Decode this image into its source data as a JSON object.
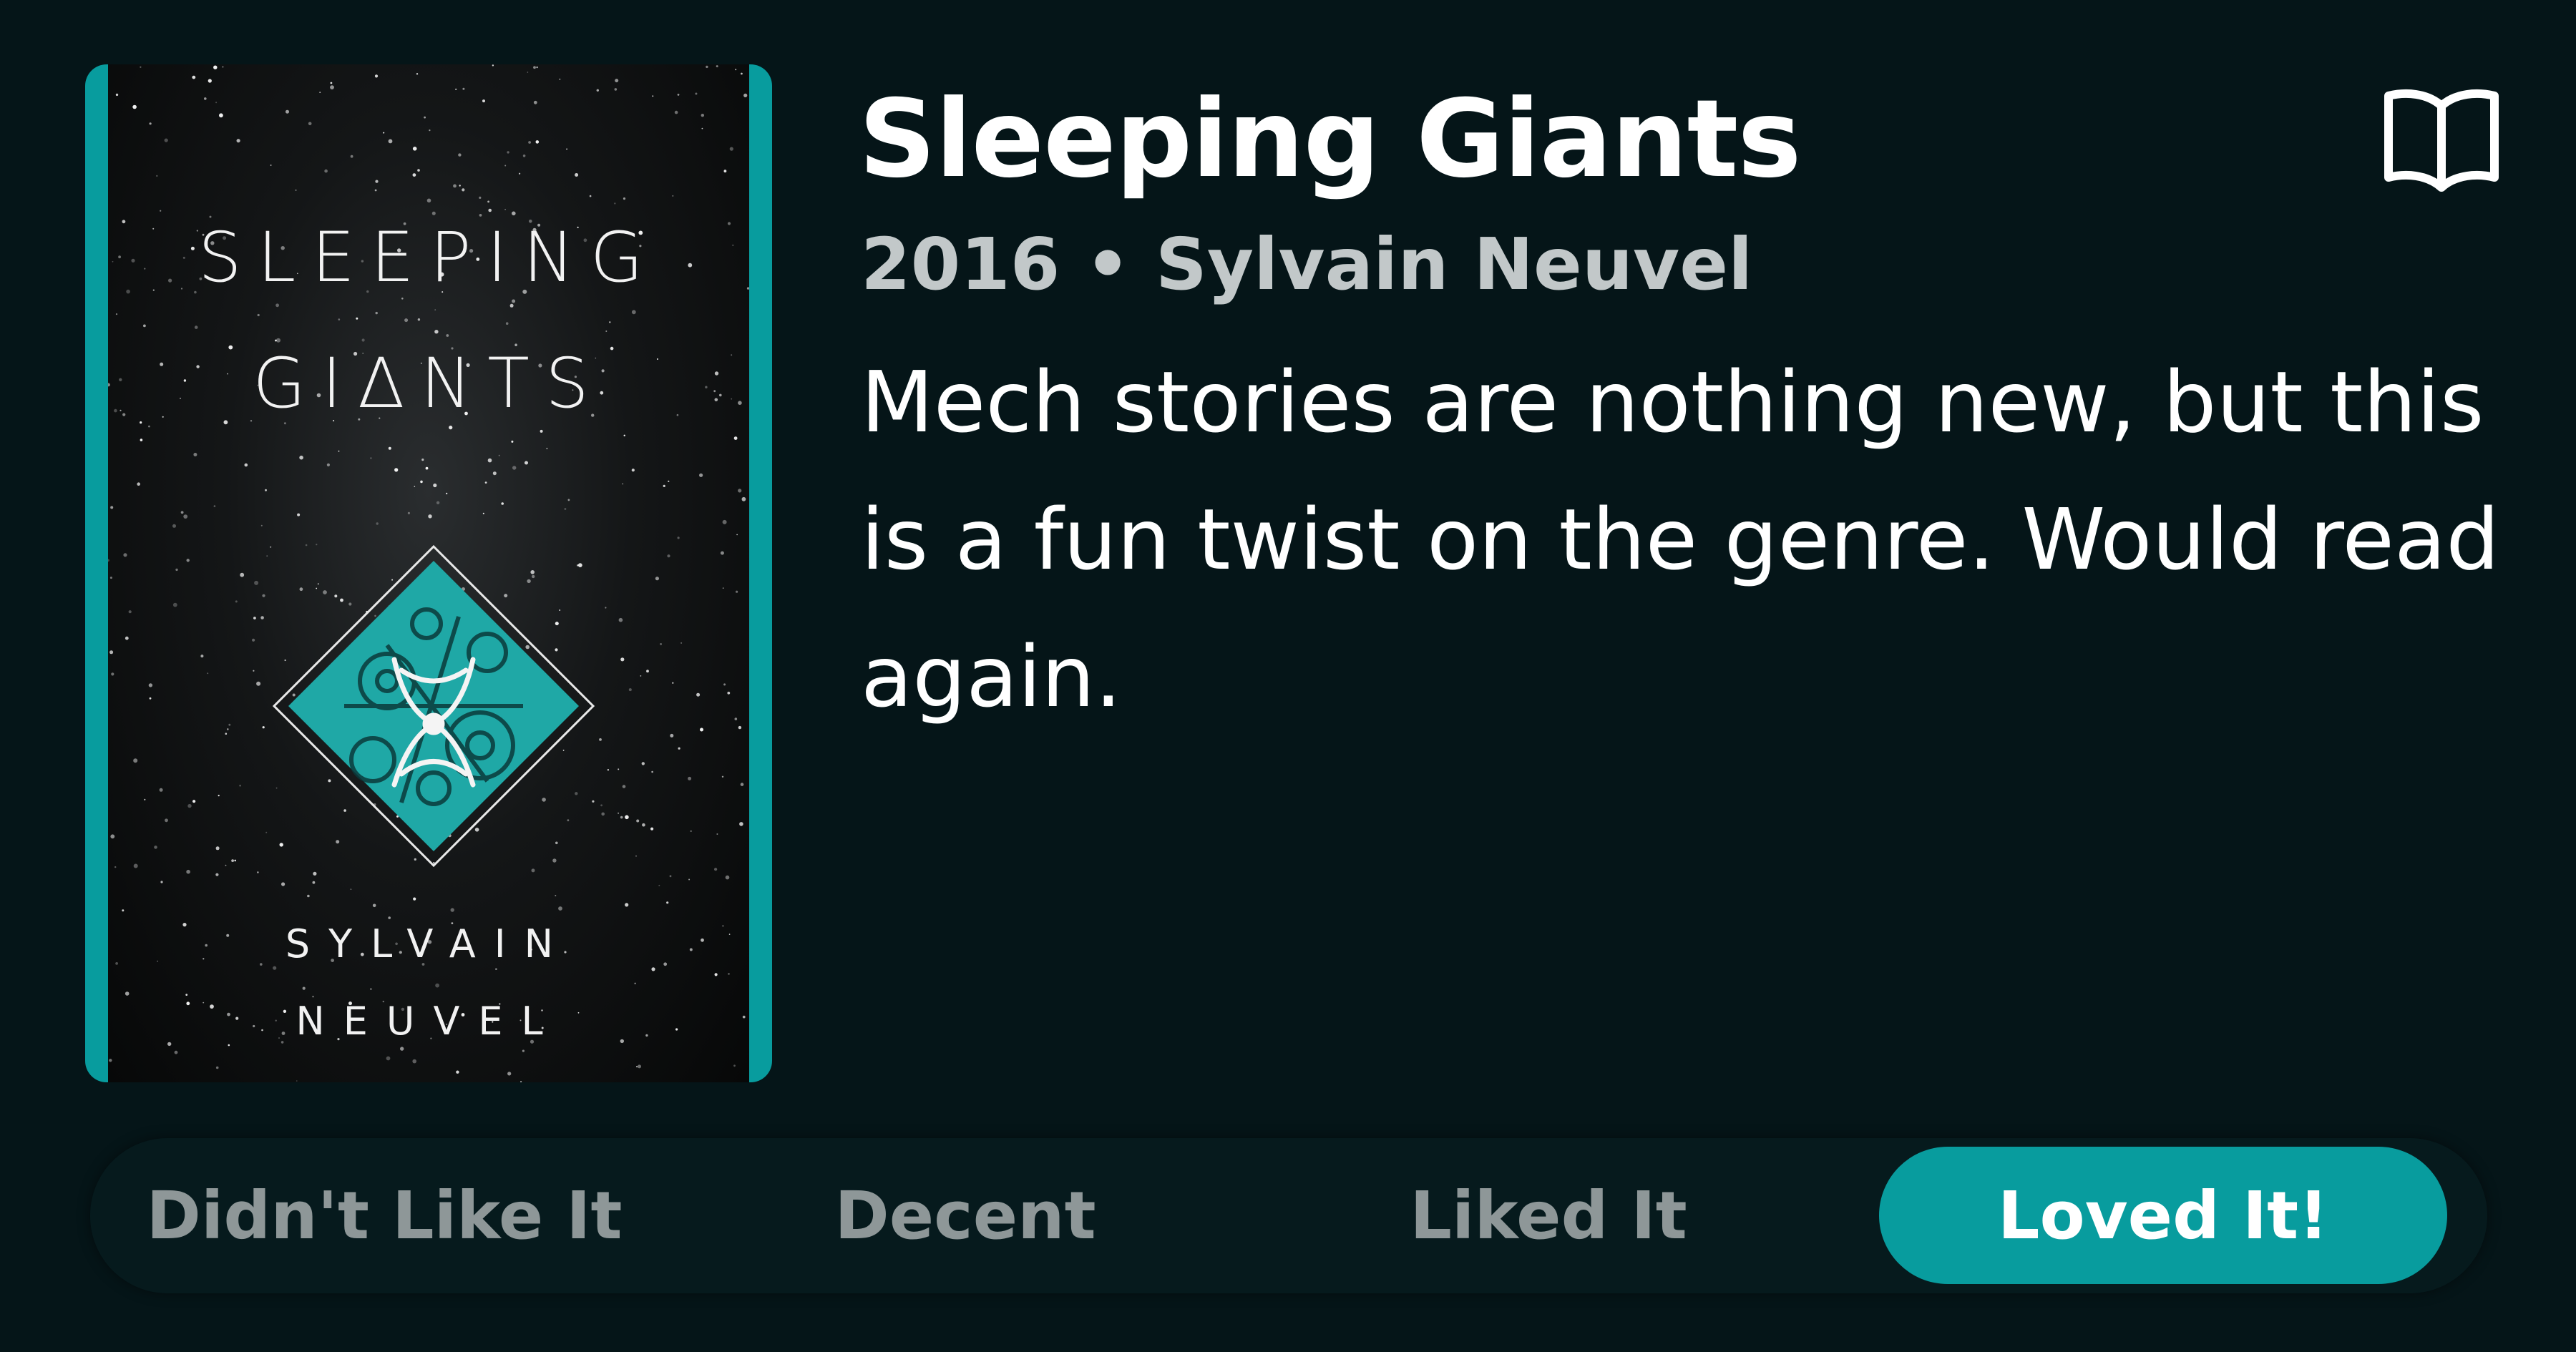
{
  "book": {
    "title": "Sleeping Giants",
    "year": "2016",
    "separator": "•",
    "author": "Sylvain Neuvel",
    "review": "Mech stories are nothing new, but this is a fun twist on the genre. Would read again."
  },
  "cover": {
    "title_line1": "SLEEPING",
    "title_line2": "GIΔNTS",
    "author_line1": "SYLVAIN",
    "author_line2": "NEUVEL",
    "border_color": "#089c9e",
    "emblem_color": "#1fa8a6"
  },
  "actions": {
    "read_icon": "open-book-icon"
  },
  "rating": {
    "options": [
      "Didn't Like It",
      "Decent",
      "Liked It",
      "Loved It!"
    ],
    "selected": "Loved It!",
    "accent_color": "#089c9e"
  }
}
